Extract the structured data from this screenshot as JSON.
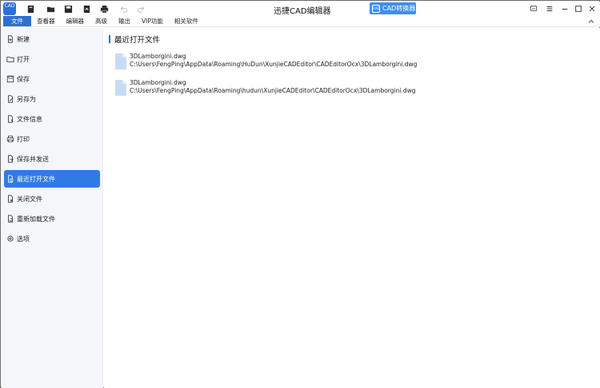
{
  "app": {
    "logo_text": "CAD",
    "title": "迅捷CAD编辑器",
    "converter_button": "CAD转换器"
  },
  "quick_toolbar": [
    "new-icon",
    "open-folder-icon",
    "save-icon",
    "export-icon",
    "print-icon",
    "undo-icon",
    "redo-icon"
  ],
  "window_controls": [
    "feedback-icon",
    "menu-icon",
    "minimize-icon",
    "maximize-icon",
    "close-icon"
  ],
  "menubar": {
    "items": [
      {
        "label": "文件",
        "active": true
      },
      {
        "label": "查看器",
        "active": false
      },
      {
        "label": "编辑器",
        "active": false
      },
      {
        "label": "高级",
        "active": false
      },
      {
        "label": "输出",
        "active": false
      },
      {
        "label": "VIP功能",
        "active": false
      },
      {
        "label": "相关软件",
        "active": false
      }
    ]
  },
  "sidebar": {
    "items": [
      {
        "label": "新建",
        "icon": "new-file-icon",
        "active": false
      },
      {
        "label": "打开",
        "icon": "open-folder-icon",
        "active": false
      },
      {
        "label": "保存",
        "icon": "save-icon",
        "active": false
      },
      {
        "label": "另存为",
        "icon": "save-as-icon",
        "active": false
      },
      {
        "label": "文件信息",
        "icon": "file-info-icon",
        "active": false
      },
      {
        "label": "打印",
        "icon": "print-icon",
        "active": false
      },
      {
        "label": "保存并发送",
        "icon": "save-send-icon",
        "active": false
      },
      {
        "label": "最近打开文件",
        "icon": "recent-files-icon",
        "active": true
      },
      {
        "label": "关闭文件",
        "icon": "close-file-icon",
        "active": false
      },
      {
        "label": "重新加载文件",
        "icon": "reload-file-icon",
        "active": false
      },
      {
        "label": "选项",
        "icon": "gear-icon",
        "active": false
      }
    ]
  },
  "main": {
    "heading": "最近打开文件",
    "recent_files": [
      {
        "name": "3DLamborgini.dwg",
        "path": "C:\\Users\\FengPing\\AppData\\Roaming\\HuDun\\XunjieCADEditor\\CADEditorOcx\\3DLamborgini.dwg"
      },
      {
        "name": "3DLamborgini.dwg",
        "path": "C:\\Users\\FengPing\\AppData\\Roaming\\hudun\\XunjieCADEditor\\CADEditorOcx\\3DLamborgini.dwg"
      }
    ]
  },
  "colors": {
    "accent": "#2f6fd0",
    "sidebar_active": "#2f7be5",
    "sidebar_bg": "#f4f6f9",
    "converter_button": "#3d8ef0",
    "file_icon": "#c7dcf3"
  }
}
